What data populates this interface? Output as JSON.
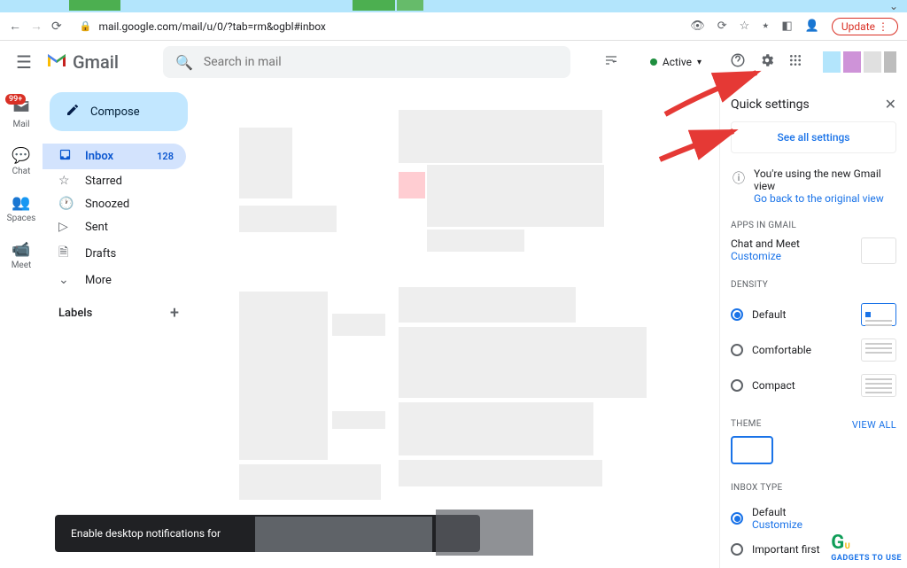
{
  "browser": {
    "url": "mail.google.com/mail/u/0/?tab=rm&ogbl#inbox",
    "update": "Update"
  },
  "gmail": {
    "brand": "Gmail",
    "search_placeholder": "Search in mail",
    "active": "Active"
  },
  "leftbar": {
    "mail": "Mail",
    "mail_badge": "99+",
    "chat": "Chat",
    "spaces": "Spaces",
    "meet": "Meet"
  },
  "sidebar": {
    "compose": "Compose",
    "items": [
      {
        "label": "Inbox",
        "count": "128"
      },
      {
        "label": "Starred"
      },
      {
        "label": "Snoozed"
      },
      {
        "label": "Sent"
      },
      {
        "label": "Drafts"
      },
      {
        "label": "More"
      }
    ],
    "labels": "Labels"
  },
  "settings": {
    "title": "Quick settings",
    "see_all": "See all settings",
    "info_text": "You're using the new Gmail view",
    "info_link": "Go back to the original view",
    "apps_title": "Apps in Gmail",
    "apps_label": "Chat and Meet",
    "customize": "Customize",
    "density_title": "Density",
    "density": [
      "Default",
      "Comfortable",
      "Compact"
    ],
    "theme_title": "Theme",
    "view_all": "View all",
    "inbox_title": "Inbox type",
    "inbox_default": "Default",
    "inbox_important": "Important first"
  },
  "toast": "Enable desktop notifications for",
  "watermark": "GADGETS TO USE"
}
